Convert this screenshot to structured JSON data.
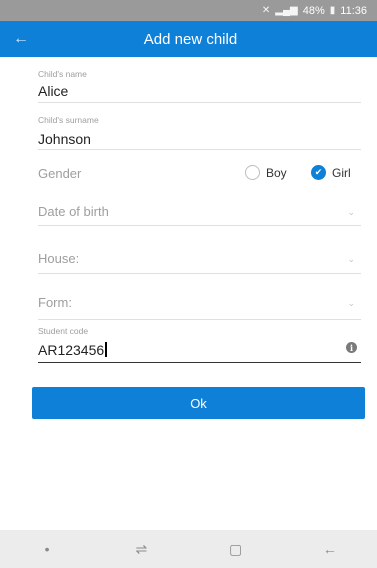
{
  "status_bar": {
    "battery": "48%",
    "time": "11:36",
    "mute_icon": "mute-icon",
    "signal_icon": "signal-icon",
    "battery_icon": "battery-icon"
  },
  "app_bar": {
    "title": "Add new child",
    "back_icon": "arrow-left-icon"
  },
  "form": {
    "name": {
      "label": "Child's name",
      "value": "Alice"
    },
    "surname": {
      "label": "Child's surname",
      "value": "Johnson"
    },
    "gender": {
      "label": "Gender",
      "options": [
        "Boy",
        "Girl"
      ],
      "selected": "Girl"
    },
    "date_of_birth": {
      "placeholder": "Date of birth"
    },
    "house": {
      "placeholder": "House:"
    },
    "form_field": {
      "placeholder": "Form:"
    },
    "student_code": {
      "label": "Student code",
      "value": "AR123456"
    }
  },
  "ok_button": {
    "label": "Ok"
  },
  "colors": {
    "accent": "#0f80d8",
    "status_bar": "#9a9a9a",
    "nav_bar": "#ececec"
  },
  "nav_bar": {
    "icons": [
      "dot-icon",
      "recent-apps-icon",
      "home-icon",
      "back-icon"
    ]
  }
}
